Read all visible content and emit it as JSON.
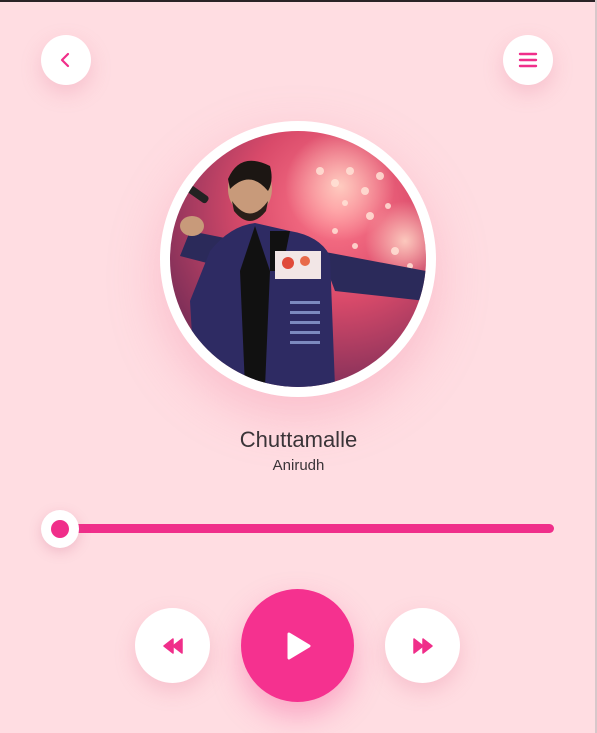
{
  "player": {
    "song_title": "Chuttamalle",
    "artist": "Anirudh",
    "progress": 0.0
  },
  "icons": {
    "back": "chevron-left-icon",
    "menu": "hamburger-menu-icon",
    "rewind": "rewind-icon",
    "play": "play-icon",
    "forward": "fast-forward-icon"
  },
  "colors": {
    "background": "#ffdde2",
    "accent": "#f02e8a",
    "button_bg": "#ffffff",
    "text": "#3a3438"
  }
}
